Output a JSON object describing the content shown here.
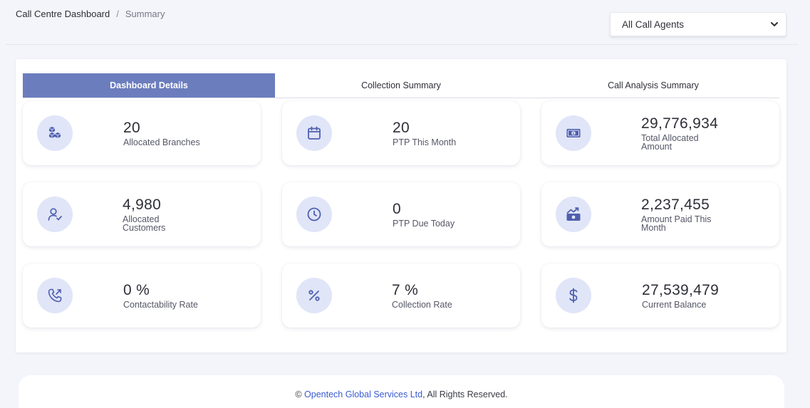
{
  "breadcrumb": {
    "root": "Call Centre Dashboard",
    "separator": "/",
    "current": "Summary"
  },
  "agent_filter": {
    "selected": "All Call Agents"
  },
  "tabs": [
    {
      "label": "Dashboard Details",
      "active": true
    },
    {
      "label": "Collection Summary",
      "active": false
    },
    {
      "label": "Call Analysis Summary",
      "active": false
    }
  ],
  "cards": [
    {
      "value": "20",
      "label": "Allocated Branches",
      "icon": "boxes-icon"
    },
    {
      "value": "20",
      "label": "PTP This Month",
      "icon": "calendar-icon"
    },
    {
      "value": "29,776,934",
      "label": "Total Allocated Amount",
      "icon": "banknote-icon"
    },
    {
      "value": "4,980",
      "label": "Allocated Customers",
      "icon": "user-check-icon"
    },
    {
      "value": "0",
      "label": "PTP Due Today",
      "icon": "clock-icon"
    },
    {
      "value": "2,237,455",
      "label": "Amount Paid This Month",
      "icon": "money-trend-icon"
    },
    {
      "value": "0 %",
      "label": "Contactability Rate",
      "icon": "phone-outgoing-icon"
    },
    {
      "value": "7 %",
      "label": "Collection Rate",
      "icon": "percent-icon"
    },
    {
      "value": "27,539,479",
      "label": "Current Balance",
      "icon": "dollar-icon"
    }
  ],
  "footer": {
    "prefix": "© ",
    "company": "Opentech Global Services Ltd",
    "suffix": ", All Rights Reserved."
  },
  "colors": {
    "accent": "#6b7dbd",
    "icon_bg": "#e0e5f8",
    "icon_fg": "#4f5fae",
    "link": "#3a5bd0"
  }
}
